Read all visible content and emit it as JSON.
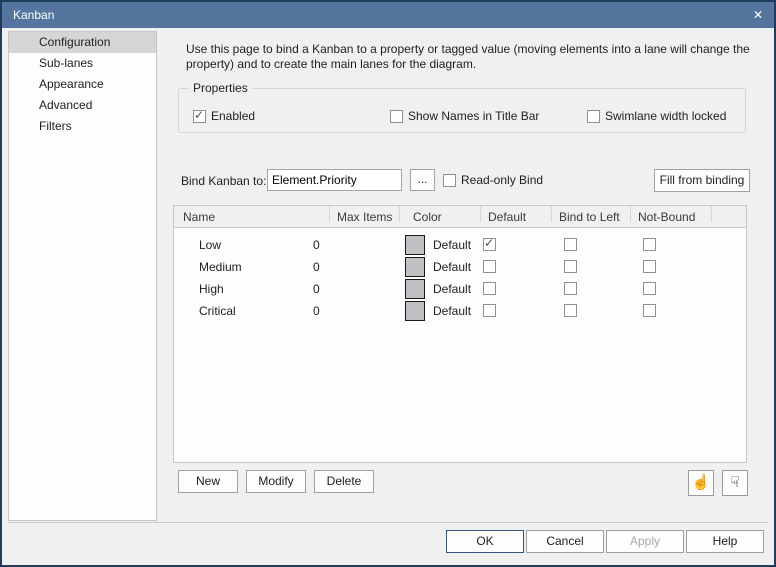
{
  "window": {
    "title": "Kanban",
    "close_glyph": "✕"
  },
  "sidebar": {
    "items": [
      {
        "label": "Configuration",
        "selected": true
      },
      {
        "label": "Sub-lanes",
        "selected": false
      },
      {
        "label": "Appearance",
        "selected": false
      },
      {
        "label": "Advanced",
        "selected": false
      },
      {
        "label": "Filters",
        "selected": false
      }
    ]
  },
  "description": "Use this page to bind a Kanban to a property or tagged value (moving elements into a lane will change the property) and to create the main lanes for the diagram.",
  "properties": {
    "legend": "Properties",
    "checkboxes": [
      {
        "label": "Enabled",
        "checked": true
      },
      {
        "label": "Show Names in Title Bar",
        "checked": false
      },
      {
        "label": "Swimlane width locked",
        "checked": false
      }
    ]
  },
  "bind": {
    "label": "Bind Kanban to:",
    "value": "Element.Priority",
    "browse_label": "...",
    "readonly": {
      "label": "Read-only Bind",
      "checked": false
    },
    "fill_button": "Fill from binding"
  },
  "table": {
    "headers": [
      "Name",
      "Max Items",
      "Color",
      "Default",
      "Bind to Left",
      "Not-Bound"
    ],
    "swatch_color": "#c1c0c5",
    "rows": [
      {
        "name": "Low",
        "max_items": "0",
        "color": "Default",
        "default": true,
        "bind_to_left": false,
        "not_bound": false
      },
      {
        "name": "Medium",
        "max_items": "0",
        "color": "Default",
        "default": false,
        "bind_to_left": false,
        "not_bound": false
      },
      {
        "name": "High",
        "max_items": "0",
        "color": "Default",
        "default": false,
        "bind_to_left": false,
        "not_bound": false
      },
      {
        "name": "Critical",
        "max_items": "0",
        "color": "Default",
        "default": false,
        "bind_to_left": false,
        "not_bound": false
      }
    ]
  },
  "actions": {
    "new": "New",
    "modify": "Modify",
    "delete": "Delete",
    "move_up_icon": "☝",
    "move_down_icon": "☟"
  },
  "footer": {
    "ok": "OK",
    "cancel": "Cancel",
    "apply": "Apply",
    "help": "Help"
  },
  "colors": {
    "titlebar": "#53759e",
    "dialog_border": "#1f3c5c",
    "background": "#f0f0f0",
    "selected_item": "#d5d5d5",
    "swatch": "#c1c0c5"
  }
}
